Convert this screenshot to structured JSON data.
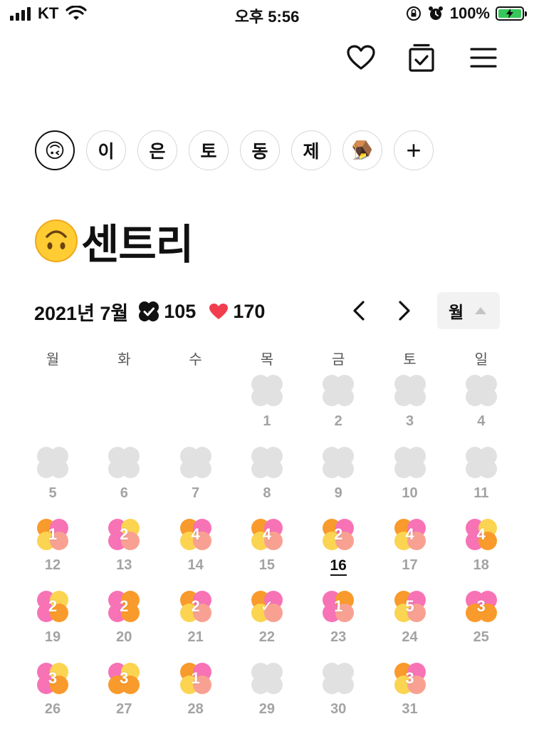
{
  "status_bar": {
    "carrier": "KT",
    "time": "오후 5:56",
    "battery": "100%"
  },
  "toolbar": {
    "icons": [
      "heart-outline-icon",
      "calendar-check-icon",
      "menu-icon"
    ]
  },
  "groups": [
    {
      "label": "🙃",
      "active": true
    },
    {
      "label": "이",
      "active": false
    },
    {
      "label": "은",
      "active": false
    },
    {
      "label": "토",
      "active": false
    },
    {
      "label": "동",
      "active": false
    },
    {
      "label": "제",
      "active": false
    },
    {
      "label": "🪤",
      "active": false
    },
    {
      "label": "+",
      "active": false
    }
  ],
  "title": {
    "emoji": "🙃",
    "text": "센트리"
  },
  "summary": {
    "year_month": "2021년 7월",
    "check_count": "105",
    "heart_count": "170"
  },
  "view_select": {
    "value": "월"
  },
  "calendar": {
    "weekdays": [
      "월",
      "화",
      "수",
      "목",
      "금",
      "토",
      "일"
    ],
    "first_weekday_index": 3,
    "today": 16,
    "colors": {
      "empty": "#e1e1e1",
      "pink": "#f773b5",
      "orange": "#f99a2c",
      "yellow": "#fbd451",
      "salmon": "#f8a192"
    },
    "days": [
      {
        "day": "1",
        "label": "",
        "petals": [
          "empty",
          "empty",
          "empty",
          "empty"
        ]
      },
      {
        "day": "2",
        "label": "",
        "petals": [
          "empty",
          "empty",
          "empty",
          "empty"
        ]
      },
      {
        "day": "3",
        "label": "",
        "petals": [
          "empty",
          "empty",
          "empty",
          "empty"
        ]
      },
      {
        "day": "4",
        "label": "",
        "petals": [
          "empty",
          "empty",
          "empty",
          "empty"
        ]
      },
      {
        "day": "5",
        "label": "",
        "petals": [
          "empty",
          "empty",
          "empty",
          "empty"
        ]
      },
      {
        "day": "6",
        "label": "",
        "petals": [
          "empty",
          "empty",
          "empty",
          "empty"
        ]
      },
      {
        "day": "7",
        "label": "",
        "petals": [
          "empty",
          "empty",
          "empty",
          "empty"
        ]
      },
      {
        "day": "8",
        "label": "",
        "petals": [
          "empty",
          "empty",
          "empty",
          "empty"
        ]
      },
      {
        "day": "9",
        "label": "",
        "petals": [
          "empty",
          "empty",
          "empty",
          "empty"
        ]
      },
      {
        "day": "10",
        "label": "",
        "petals": [
          "empty",
          "empty",
          "empty",
          "empty"
        ]
      },
      {
        "day": "11",
        "label": "",
        "petals": [
          "empty",
          "empty",
          "empty",
          "empty"
        ]
      },
      {
        "day": "12",
        "label": "1",
        "petals": [
          "orange",
          "pink",
          "yellow",
          "salmon"
        ]
      },
      {
        "day": "13",
        "label": "2",
        "petals": [
          "pink",
          "yellow",
          "pink",
          "salmon"
        ]
      },
      {
        "day": "14",
        "label": "4",
        "petals": [
          "orange",
          "pink",
          "yellow",
          "salmon"
        ]
      },
      {
        "day": "15",
        "label": "4",
        "petals": [
          "orange",
          "pink",
          "yellow",
          "salmon"
        ]
      },
      {
        "day": "16",
        "label": "2",
        "petals": [
          "orange",
          "pink",
          "yellow",
          "salmon"
        ]
      },
      {
        "day": "17",
        "label": "4",
        "petals": [
          "orange",
          "pink",
          "yellow",
          "salmon"
        ]
      },
      {
        "day": "18",
        "label": "4",
        "petals": [
          "pink",
          "yellow",
          "pink",
          "orange"
        ]
      },
      {
        "day": "19",
        "label": "2",
        "petals": [
          "pink",
          "yellow",
          "pink",
          "orange"
        ]
      },
      {
        "day": "20",
        "label": "2",
        "petals": [
          "pink",
          "orange",
          "pink",
          "orange"
        ]
      },
      {
        "day": "21",
        "label": "2",
        "petals": [
          "orange",
          "pink",
          "yellow",
          "salmon"
        ]
      },
      {
        "day": "22",
        "label": "✓",
        "petals": [
          "orange",
          "pink",
          "yellow",
          "salmon"
        ]
      },
      {
        "day": "23",
        "label": "1",
        "petals": [
          "pink",
          "orange",
          "pink",
          "salmon"
        ]
      },
      {
        "day": "24",
        "label": "5",
        "petals": [
          "orange",
          "pink",
          "yellow",
          "salmon"
        ]
      },
      {
        "day": "25",
        "label": "3",
        "petals": [
          "pink",
          "pink",
          "orange",
          "orange"
        ]
      },
      {
        "day": "26",
        "label": "3",
        "petals": [
          "pink",
          "yellow",
          "pink",
          "orange"
        ]
      },
      {
        "day": "27",
        "label": "3",
        "petals": [
          "pink",
          "yellow",
          "orange",
          "orange"
        ]
      },
      {
        "day": "28",
        "label": "1",
        "petals": [
          "orange",
          "pink",
          "yellow",
          "salmon"
        ]
      },
      {
        "day": "29",
        "label": "",
        "petals": [
          "empty",
          "empty",
          "empty",
          "empty"
        ]
      },
      {
        "day": "30",
        "label": "",
        "petals": [
          "empty",
          "empty",
          "empty",
          "empty"
        ]
      },
      {
        "day": "31",
        "label": "3",
        "petals": [
          "orange",
          "pink",
          "yellow",
          "salmon"
        ]
      }
    ]
  }
}
